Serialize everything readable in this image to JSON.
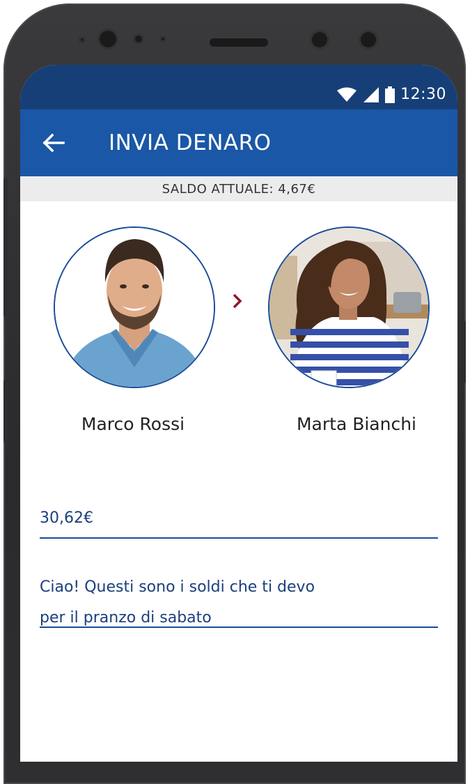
{
  "status_bar": {
    "time": "12:30",
    "icons": [
      "wifi-icon",
      "signal-icon",
      "battery-icon"
    ]
  },
  "header": {
    "back_icon": "arrow-left-icon",
    "title": "INVIA DENARO"
  },
  "balance": {
    "text": "SALDO ATTUALE: 4,67€"
  },
  "transfer": {
    "sender": {
      "name": "Marco Rossi"
    },
    "receiver": {
      "name": "Marta Bianchi"
    },
    "direction_icon": "chevron-right-icon"
  },
  "form": {
    "amount": "30,62€",
    "message_line1": "Ciao! Questi sono i soldi che ti devo",
    "message_line2": "per il pranzo di sabato"
  },
  "colors": {
    "status_bar": "#173f77",
    "app_bar": "#1a57a6",
    "accent": "#1a4b9a",
    "arrow": "#8b1a2b"
  }
}
